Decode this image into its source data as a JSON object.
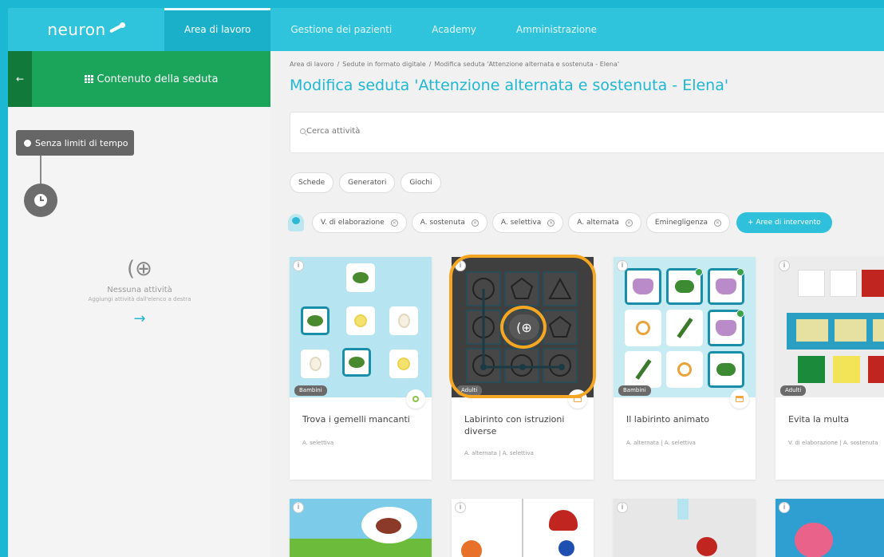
{
  "nav": {
    "logo": "neuron",
    "items": [
      {
        "label": "Area di lavoro",
        "active": true
      },
      {
        "label": "Gestione dei pazienti",
        "active": false
      },
      {
        "label": "Academy",
        "active": false
      },
      {
        "label": "Amministrazione",
        "active": false
      }
    ]
  },
  "left": {
    "back_label": "←",
    "tab_label": "Contenuto della seduta",
    "time_label": "Senza limiti di tempo",
    "empty_icon": "(⊕",
    "empty_title": "Nessuna attività",
    "empty_sub": "Aggiungi attività dall'elenco a destra",
    "empty_arrow": "→"
  },
  "main": {
    "breadcrumb": [
      "Area di lavoro",
      "Sedute in formato digitale",
      "Modifica seduta 'Attenzione alternata e sostenuta - Elena'"
    ],
    "breadcrumb_sep": "/",
    "title": "Modifica seduta 'Attenzione alternata e sostenuta - Elena'",
    "search_placeholder": "Cerca attività",
    "type_filters": [
      "Schede",
      "Generatori",
      "Giochi"
    ],
    "area_filters": [
      "V. di elaborazione",
      "A. sostenuta",
      "A. selettiva",
      "A. alternata",
      "Eminegligenza"
    ],
    "add_area_label": "+ Aree di intervento"
  },
  "cards": [
    {
      "title": "Trova i gemelli mancanti",
      "tags": "A. selettiva",
      "age": "Bambini",
      "type_icon": "gears-icon"
    },
    {
      "title": "Labirinto con istruzioni diverse",
      "tags": "A. alternata | A. selettiva",
      "age": "Adulti",
      "type_icon": "sheet-icon"
    },
    {
      "title": "Il labirinto animato",
      "tags": "A. alternata | A. selettiva",
      "age": "Bambini",
      "type_icon": "sheet-icon"
    },
    {
      "title": "Evita la multa",
      "tags": "V. di elaborazione | A. sostenuta",
      "age": "Adulti",
      "type_icon": "sheet-icon"
    }
  ],
  "overlay": {
    "add_symbol": "(⊕",
    "highlight_color": "#f5a623"
  },
  "colors": {
    "brand": "#2fc4dc",
    "green": "#1aa55a",
    "dark_green": "#117a3a"
  }
}
